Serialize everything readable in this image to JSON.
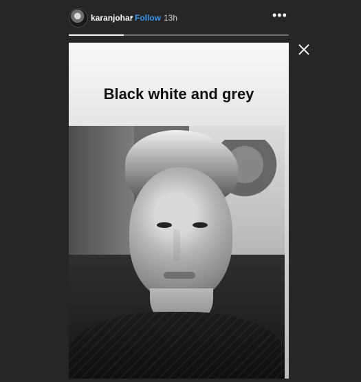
{
  "header": {
    "username": "karanjohar",
    "separator": "•",
    "follow_label": "Follow",
    "time_ago": "13h",
    "more_label": "•••"
  },
  "progress": {
    "value_fraction": 0.25
  },
  "story": {
    "caption": "Black white and grey"
  },
  "icons": {
    "avatar": "profile-avatar",
    "close": "close-icon",
    "more": "more-options-icon"
  }
}
